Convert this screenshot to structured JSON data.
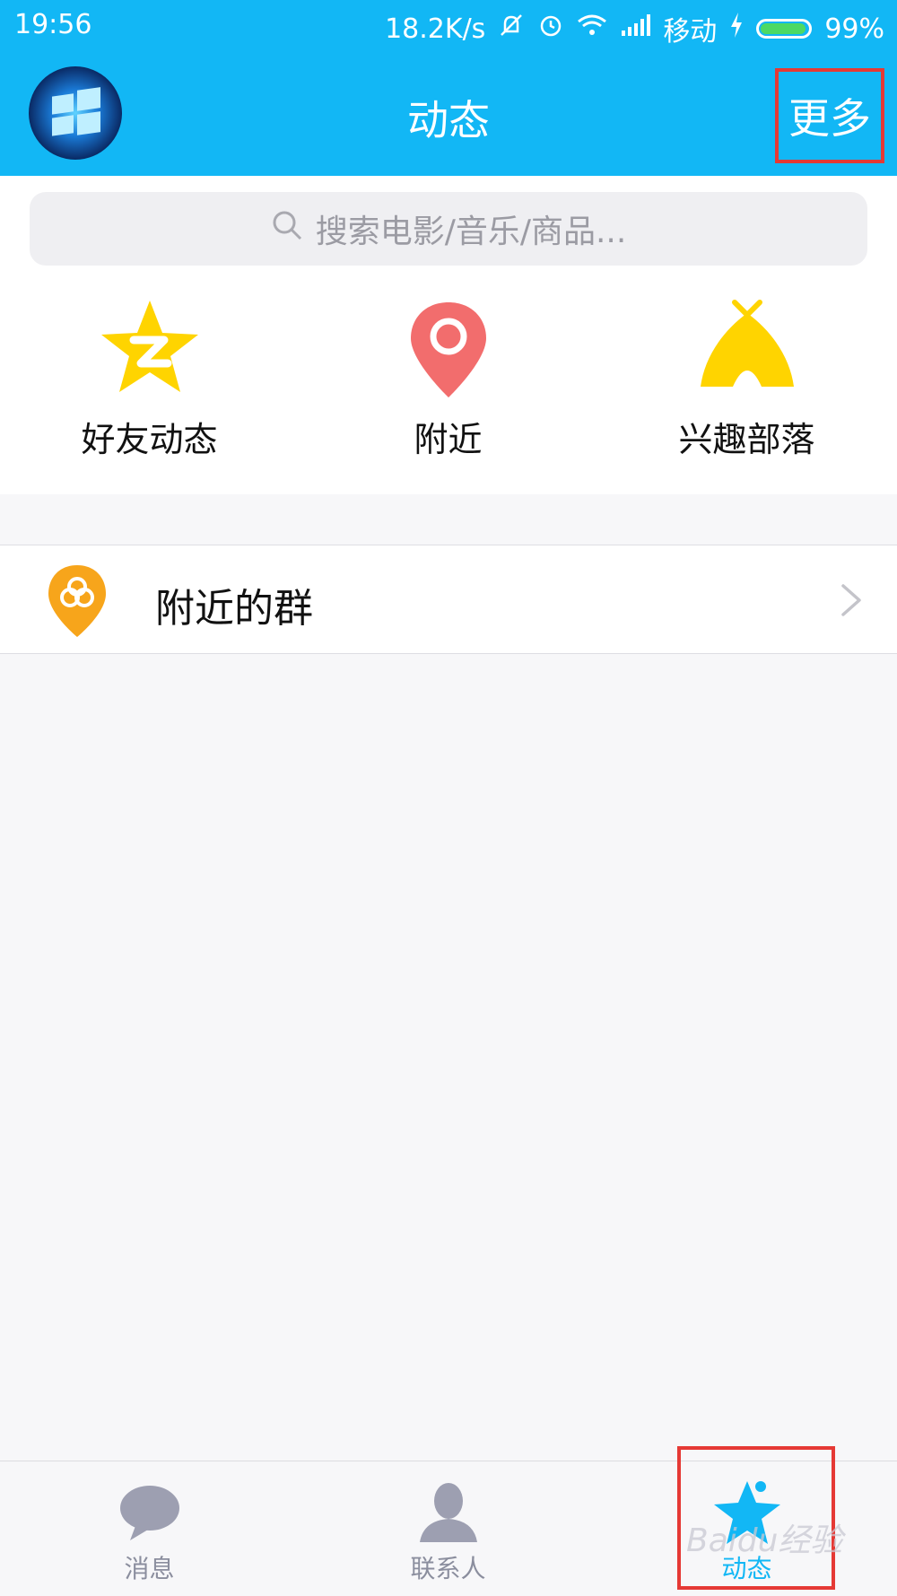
{
  "status_bar": {
    "time": "19:56",
    "net_speed": "18.2K/s",
    "carrier": "移动",
    "battery": "99%"
  },
  "header": {
    "title": "动态",
    "more_label": "更多"
  },
  "search": {
    "placeholder": "搜索电影/音乐/商品..."
  },
  "quick_actions": [
    {
      "label": "好友动态",
      "icon": "star-icon"
    },
    {
      "label": "附近",
      "icon": "location-pin-icon"
    },
    {
      "label": "兴趣部落",
      "icon": "tent-icon"
    }
  ],
  "list": {
    "nearby_groups_label": "附近的群"
  },
  "tabbar": {
    "items": [
      {
        "label": "消息",
        "icon": "chat-bubble-icon"
      },
      {
        "label": "联系人",
        "icon": "person-icon"
      },
      {
        "label": "动态",
        "icon": "star-icon",
        "active": true
      }
    ]
  },
  "watermark": "Baidu经验",
  "colors": {
    "brand_blue": "#12b7f5",
    "highlight_red": "#e53935",
    "star_yellow": "#ffd400",
    "pin_red": "#f26d6d",
    "group_orange": "#f7a51b"
  }
}
